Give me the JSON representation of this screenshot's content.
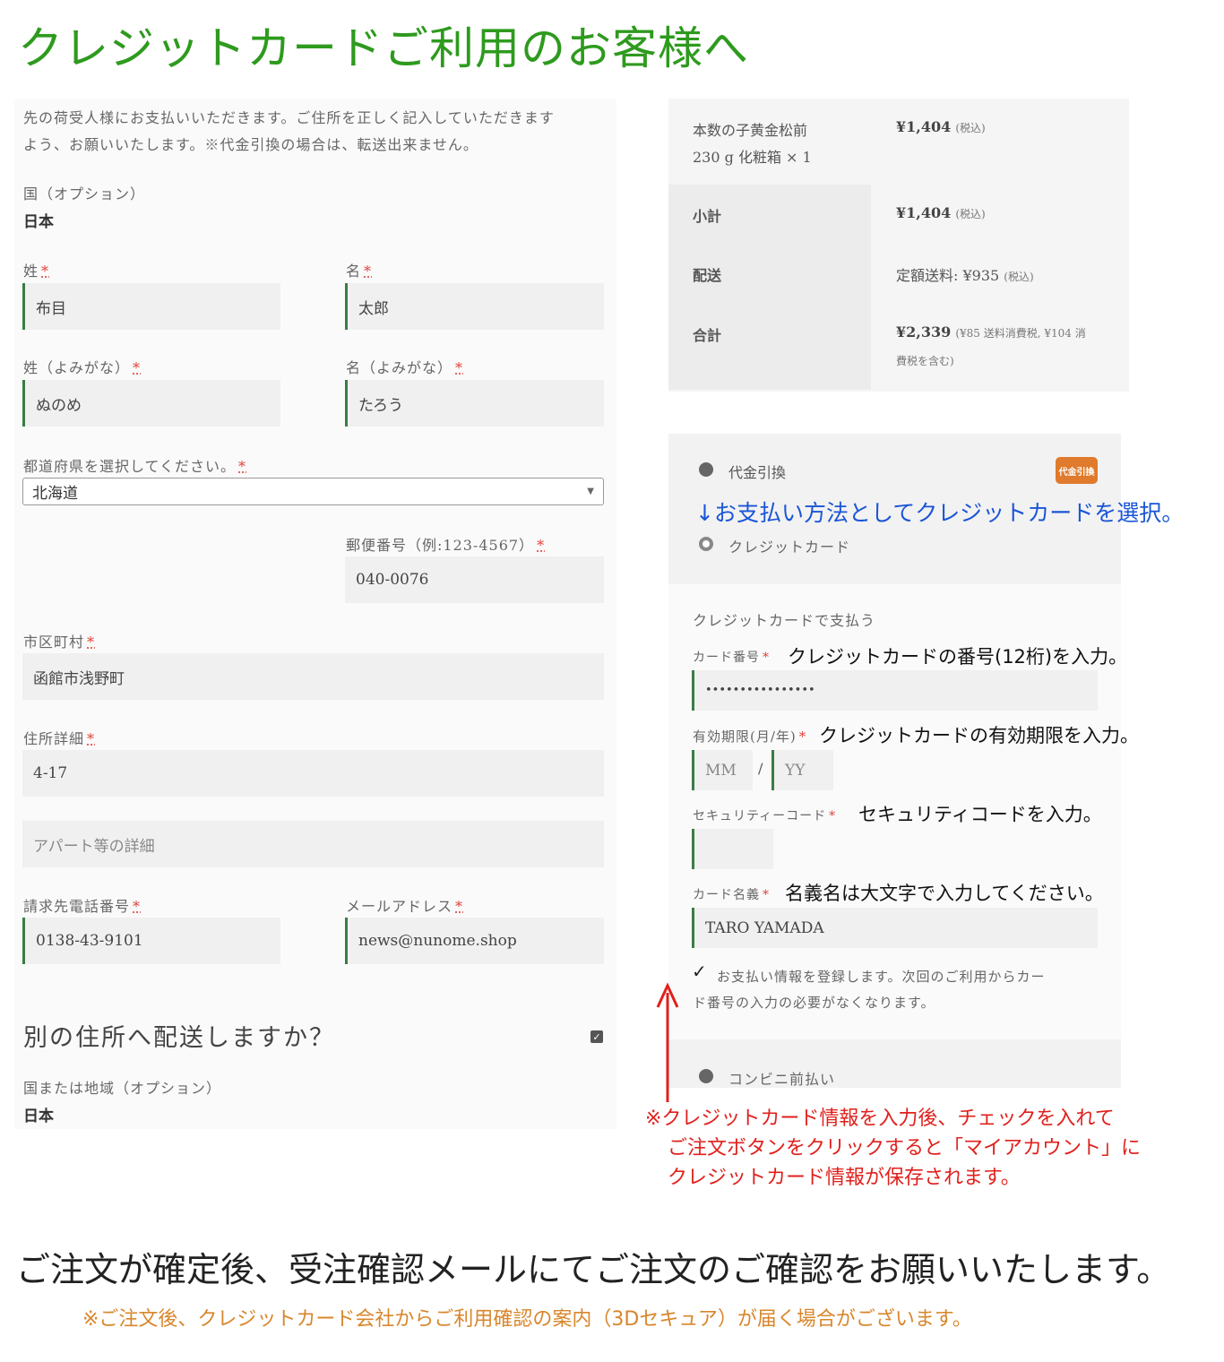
{
  "title": "クレジットカードご利用のお客様へ",
  "billing": {
    "notice_line1": "先の荷受人様にお支払いいただきます。ご住所を正しく記入していただきます",
    "notice_line2": "よう、お願いいたします。※代金引換の場合は、転送出来ません。",
    "country_label": "国（オプション）",
    "country_value": "日本",
    "last_name_label": "姓",
    "last_name_value": "布目",
    "first_name_label": "名",
    "first_name_value": "太郎",
    "last_kana_label": "姓（よみがな）",
    "last_kana_value": "ぬのめ",
    "first_kana_label": "名（よみがな）",
    "first_kana_value": "たろう",
    "prefecture_label": "都道府県を選択してください。",
    "prefecture_value": "北海道",
    "postcode_label": "郵便番号（例:123-4567）",
    "postcode_value": "040-0076",
    "city_label": "市区町村",
    "city_value": "函館市浅野町",
    "address_label": "住所詳細",
    "address_value": "4-17",
    "address2_placeholder": "アパート等の詳細",
    "phone_label": "請求先電話番号",
    "phone_value": "0138-43-9101",
    "email_label": "メールアドレス",
    "email_value": "news@nunome.shop",
    "required_mark": "*"
  },
  "shipping": {
    "heading": "別の住所へ配送しますか？",
    "checked_mark": "✓",
    "country_label": "国または地域（オプション）",
    "country_value": "日本"
  },
  "order": {
    "item_name_line1": "本数の子黄金松前",
    "item_name_line2": "230 g 化粧箱 × 1",
    "item_price": "¥1,404",
    "tax_incl": "(税込)",
    "subtotal_label": "小計",
    "subtotal_value": "¥1,404",
    "shipping_label": "配送",
    "shipping_value": "定額送料: ¥935",
    "total_label": "合計",
    "total_value": "¥2,339",
    "total_note_line1": "(¥85 送料消費税, ¥104 消",
    "total_note_line2": "費税を含む)"
  },
  "payment": {
    "cod_label": "代金引換",
    "cod_badge": "代金引換",
    "credit_label": "クレジットカード",
    "credit_heading": "クレジットカードで支払う",
    "card_number_label": "カード番号",
    "card_number_value": "••••••••••••••••",
    "expiry_label": "有効期限(月/年)",
    "expiry_month_placeholder": "MM",
    "expiry_separator": "/",
    "expiry_year_placeholder": "YY",
    "security_label": "セキュリティーコード",
    "card_name_label": "カード名義",
    "card_name_value": "TARO YAMADA",
    "save_checkmark": "✓",
    "save_text_line1": "お支払い情報を登録します。次回のご利用からカー",
    "save_text_line2": "ド番号の入力の必要がなくなります。",
    "konbini_label": "コンビニ前払い"
  },
  "annotations": {
    "select_credit": "↓お支払い方法としてクレジットカードを選択。",
    "card_number": "クレジットカードの番号(12桁)を入力。",
    "expiry": "クレジットカードの有効期限を入力。",
    "security": "セキュリティコードを入力。",
    "card_name": "名義名は大文字で入力してください。",
    "save_line1": "※クレジットカード情報を入力後、チェックを入れて",
    "save_line2": "ご注文ボタンをクリックすると「マイアカウント」に",
    "save_line3": "クレジットカード情報が保存されます。"
  },
  "footer": {
    "main": "ご注文が確定後、受注確認メールにてご注文のご確認をお願いいたします。",
    "note": "※ご注文後、クレジットカード会社からご利用確認の案内（3Dセキュア）が届く場合がございます。"
  },
  "colors": {
    "title_green": "#2e9a1e",
    "focus_green": "#3a7d44",
    "required_red": "#e0413b",
    "annotation_blue": "#1a55d6",
    "annotation_red": "#e0201c",
    "note_orange": "#d8862b",
    "badge_orange": "#e07a2c"
  }
}
